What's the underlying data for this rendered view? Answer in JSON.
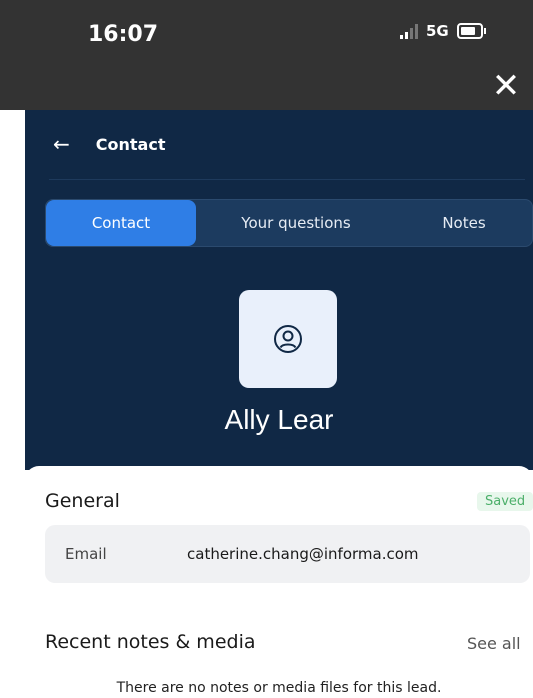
{
  "status_bar": {
    "time": "16:07",
    "network": "5G",
    "icons": [
      "signal-icon",
      "battery-icon"
    ]
  },
  "close_icon": "✕",
  "header": {
    "back_icon": "←",
    "title": "Contact"
  },
  "tabs": [
    {
      "label": "Contact",
      "active": true
    },
    {
      "label": "Your questions",
      "active": false
    },
    {
      "label": "Notes",
      "active": false
    }
  ],
  "contact": {
    "avatar_icon": "user-icon",
    "name": "Ally Lear"
  },
  "general": {
    "title": "General",
    "status": "Saved",
    "email_label": "Email",
    "email_value": "catherine.chang@informa.com"
  },
  "recent": {
    "title": "Recent notes & media",
    "see_all": "See all",
    "empty_message": "There are no notes or media files for this lead."
  },
  "colors": {
    "panel": "#102845",
    "active_tab": "#2f7ee6",
    "status_bar": "#333333",
    "saved": "#4caf6a"
  }
}
